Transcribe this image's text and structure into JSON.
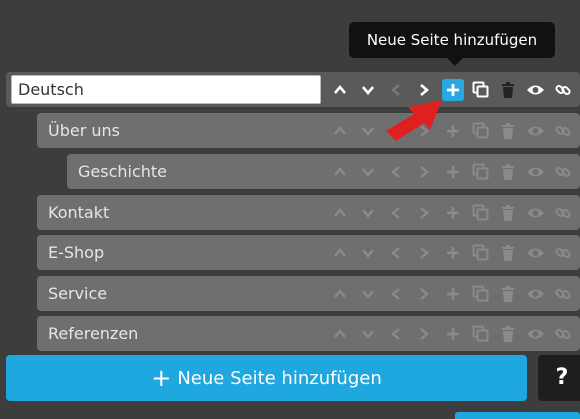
{
  "tooltip": "Neue Seite hinzufügen",
  "root": {
    "value": "Deutsch"
  },
  "pages": [
    {
      "label": "Über uns"
    },
    {
      "label": "Geschichte"
    },
    {
      "label": "Kontakt"
    },
    {
      "label": "E-Shop"
    },
    {
      "label": "Service"
    },
    {
      "label": "Referenzen"
    }
  ],
  "add_button": {
    "plus": "+",
    "label": "Neue Seite hinzufügen"
  },
  "help_button": {
    "label": "?"
  },
  "colors": {
    "accent": "#1fa7df",
    "arrow": "#e02020",
    "row": "#6f6f6f",
    "background": "#3d3d3d"
  },
  "row_icons": [
    "chevron-up-icon",
    "chevron-down-icon",
    "chevron-left-icon",
    "chevron-right-icon",
    "plus-icon",
    "copy-icon",
    "trash-icon",
    "eye-icon",
    "link-icon"
  ]
}
